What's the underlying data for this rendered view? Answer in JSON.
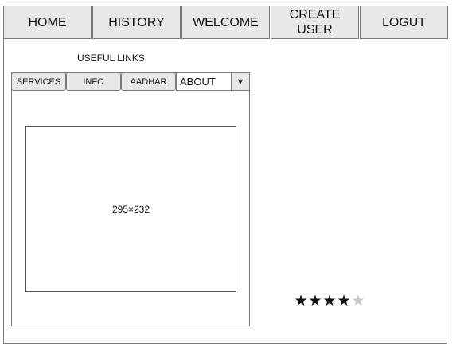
{
  "nav": {
    "items": [
      {
        "label": "HOME"
      },
      {
        "label": "HISTORY"
      },
      {
        "label": "WELCOME"
      },
      {
        "label": "CREATE\nUSER"
      },
      {
        "label": "LOGUT"
      }
    ]
  },
  "useful_links": {
    "title": "USEFUL LINKS",
    "tabs": [
      {
        "label": "SERVICES"
      },
      {
        "label": "INFO"
      },
      {
        "label": "AADHAR"
      }
    ],
    "select": {
      "value": "ABOUT",
      "arrow_icon": "triangle-down-icon"
    },
    "image_placeholder": {
      "label": "295×232"
    }
  },
  "rating": {
    "value": 4,
    "max": 5,
    "filled_color": "#111111",
    "empty_color": "#c8c8c8"
  }
}
